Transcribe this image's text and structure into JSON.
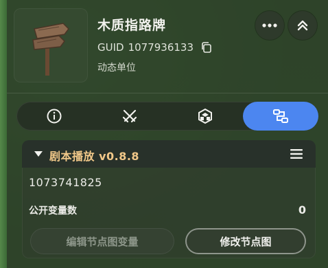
{
  "header": {
    "title": "木质指路牌",
    "guid_label": "GUID",
    "guid_value": "1077936133",
    "subtitle": "动态单位"
  },
  "tabs": [
    {
      "icon": "info-icon",
      "active": false
    },
    {
      "icon": "crossed-swords-icon",
      "active": false
    },
    {
      "icon": "cube-icon",
      "active": false
    },
    {
      "icon": "node-graph-icon",
      "active": true
    }
  ],
  "section": {
    "title": "剧本播放 v0.8.8",
    "id_value": "1073741825",
    "var_label": "公开变量数",
    "var_count": "0",
    "edit_button": "编辑节点图变量",
    "modify_button": "修改节点图"
  },
  "colors": {
    "accent": "#4c86f0",
    "section_title": "#f1c889"
  }
}
